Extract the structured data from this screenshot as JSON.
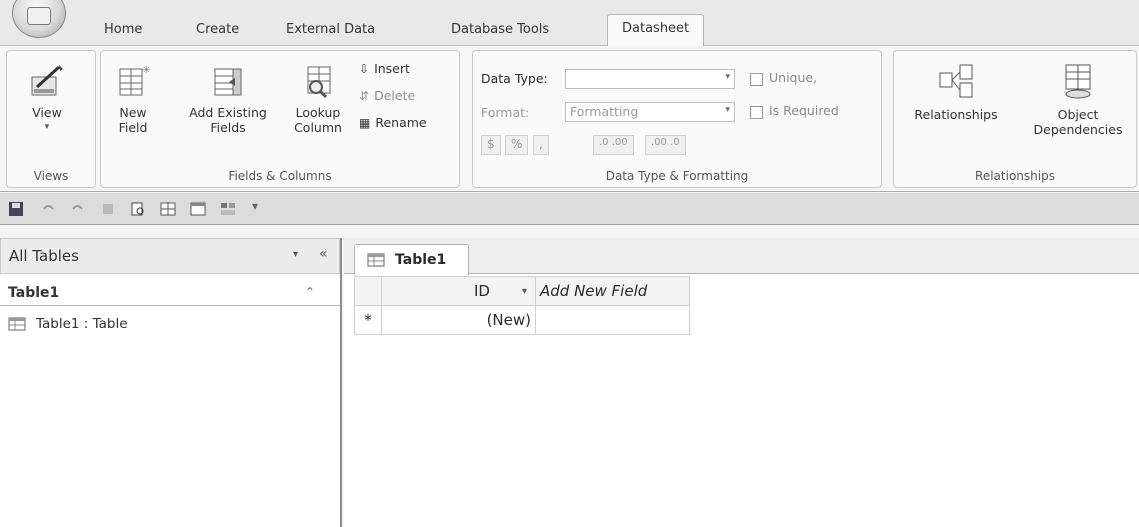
{
  "ribbon_tabs": [
    "Home",
    "Create",
    "External Data",
    "Database Tools",
    "Datasheet"
  ],
  "groups": {
    "views": {
      "label": "Views",
      "view": "View"
    },
    "fields_columns": {
      "label": "Fields & Columns",
      "new_field": [
        "New",
        "Field"
      ],
      "add_existing": [
        "Add Existing",
        "Fields"
      ],
      "lookup": [
        "Lookup",
        "Column"
      ],
      "insert": "Insert",
      "delete": "Delete",
      "rename": "Rename"
    },
    "data_type": {
      "label": "Data Type & Formatting",
      "data_type_label": "Data Type:",
      "data_type_value": "",
      "format_label": "Format:",
      "format_value": "Formatting",
      "unique": "Unique,",
      "is_required": "Is Required",
      "currency": "$",
      "percent": "%",
      "comma": ",",
      "inc_dec": ".0 .00",
      "dec_dec": ".00 .0"
    },
    "relationships": {
      "label": "Relationships",
      "relationships": "Relationships",
      "object_dep": [
        "Object",
        "Dependencies"
      ]
    }
  },
  "nav": {
    "title": "All Tables",
    "group": "Table1",
    "item": "Table1 : Table"
  },
  "document": {
    "tab": "Table1",
    "columns": [
      "ID",
      "Add New Field"
    ],
    "new_row_marker": "*",
    "new_row_value": "(New)"
  }
}
